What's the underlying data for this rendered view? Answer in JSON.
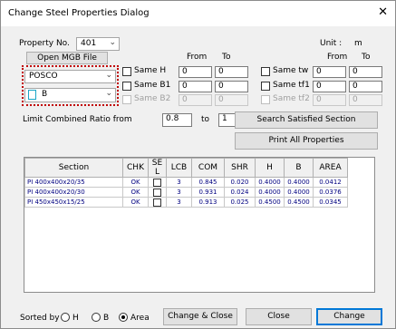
{
  "window": {
    "title": "Change Steel Properties Dialog",
    "close_glyph": "✕"
  },
  "property": {
    "label": "Property No.",
    "value": "401",
    "unit_label": "Unit :",
    "unit_value": "m"
  },
  "open_mgb": {
    "label": "Open MGB File"
  },
  "manufacturer": {
    "value": "POSCO"
  },
  "shape": {
    "value": "B"
  },
  "headers": {
    "from_left": "From",
    "to_left": "To",
    "from_right": "From",
    "to_right": "To"
  },
  "same_h": {
    "label": "Same H",
    "from": "0",
    "to": "0"
  },
  "same_b1": {
    "label": "Same B1",
    "from": "0",
    "to": "0"
  },
  "same_b2": {
    "label": "Same B2",
    "from": "0",
    "to": "0"
  },
  "same_tw": {
    "label": "Same tw",
    "from": "0",
    "to": "0"
  },
  "same_tf1": {
    "label": "Same tf1",
    "from": "0",
    "to": "0"
  },
  "same_tf2": {
    "label": "Same tf2",
    "from": "0",
    "to": "0"
  },
  "ratio": {
    "label": "Limit Combined Ratio from",
    "from": "0.8",
    "to_label": "to",
    "to": "1"
  },
  "search_button": {
    "label": "Search Satisfied Section"
  },
  "print_button": {
    "label": "Print All Properties"
  },
  "table": {
    "columns": [
      "Section",
      "CHK",
      "SE L",
      "LCB",
      "COM",
      "SHR",
      "H",
      "B",
      "AREA"
    ],
    "rows": [
      {
        "section": "PI 400x400x20/35",
        "chk": "OK",
        "lcb": "3",
        "com": "0.845",
        "shr": "0.020",
        "h": "0.4000",
        "b": "0.4000",
        "area": "0.0412"
      },
      {
        "section": "PI 400x400x20/30",
        "chk": "OK",
        "lcb": "3",
        "com": "0.931",
        "shr": "0.024",
        "h": "0.4000",
        "b": "0.4000",
        "area": "0.0376"
      },
      {
        "section": "PI 450x450x15/25",
        "chk": "OK",
        "lcb": "3",
        "com": "0.913",
        "shr": "0.025",
        "h": "0.4500",
        "b": "0.4500",
        "area": "0.0345"
      }
    ]
  },
  "sort": {
    "label": "Sorted by",
    "options": [
      "H",
      "B",
      "Area"
    ],
    "selected": "Area"
  },
  "buttons": {
    "change_close": "Change & Close",
    "close": "Close",
    "change": "Change"
  },
  "icons": {
    "dropdown": "chevron-down-icon",
    "close": "close-icon"
  },
  "colors": {
    "highlight_box": "#c00000",
    "table_text": "#000080",
    "default_button_border": "#0078d7"
  }
}
